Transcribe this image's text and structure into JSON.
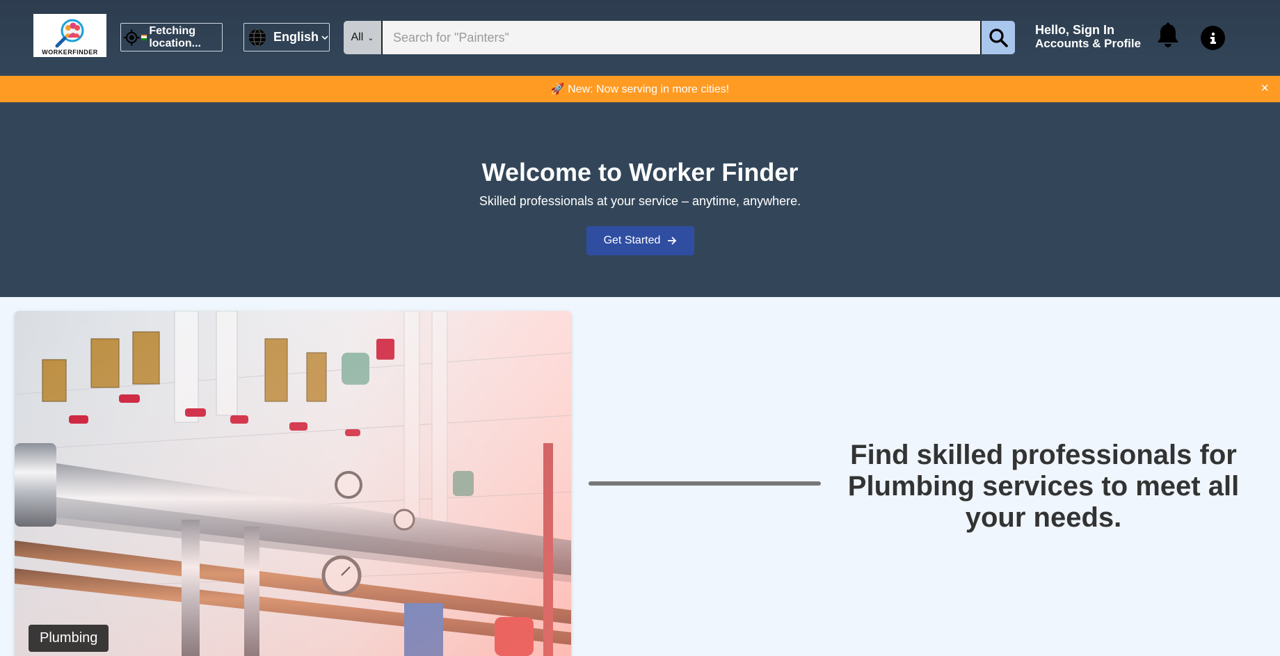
{
  "header": {
    "logo_text": "WORKERFINDER",
    "location_label": "Fetching location...",
    "language": "English",
    "search": {
      "category": "All",
      "placeholder": "Search for \"Painters\"",
      "value": ""
    },
    "account": {
      "greeting": "Hello, Sign In",
      "subtitle": "Accounts & Profile"
    },
    "icons": [
      "location-target-icon",
      "india-flag-icon",
      "globe-icon",
      "chevron-down-icon",
      "search-icon",
      "bell-icon",
      "info-icon"
    ]
  },
  "banner": {
    "text": "🚀 New: Now serving in more cities!",
    "close": "×"
  },
  "hero": {
    "title": "Welcome to Worker Finder",
    "subtitle": "Skilled professionals at your service – anytime, anywhere.",
    "cta_label": "Get Started"
  },
  "feature": {
    "image_caption": "Plumbing",
    "headline": "Find skilled professionals for Plumbing services to meet all your needs."
  },
  "colors": {
    "navbar": "#2d3d4f",
    "hero": "#334659",
    "banner": "#ff9a22",
    "cta": "#2f4ea2",
    "search_button": "#a9c6ec",
    "page_background": "#eff6fd"
  }
}
